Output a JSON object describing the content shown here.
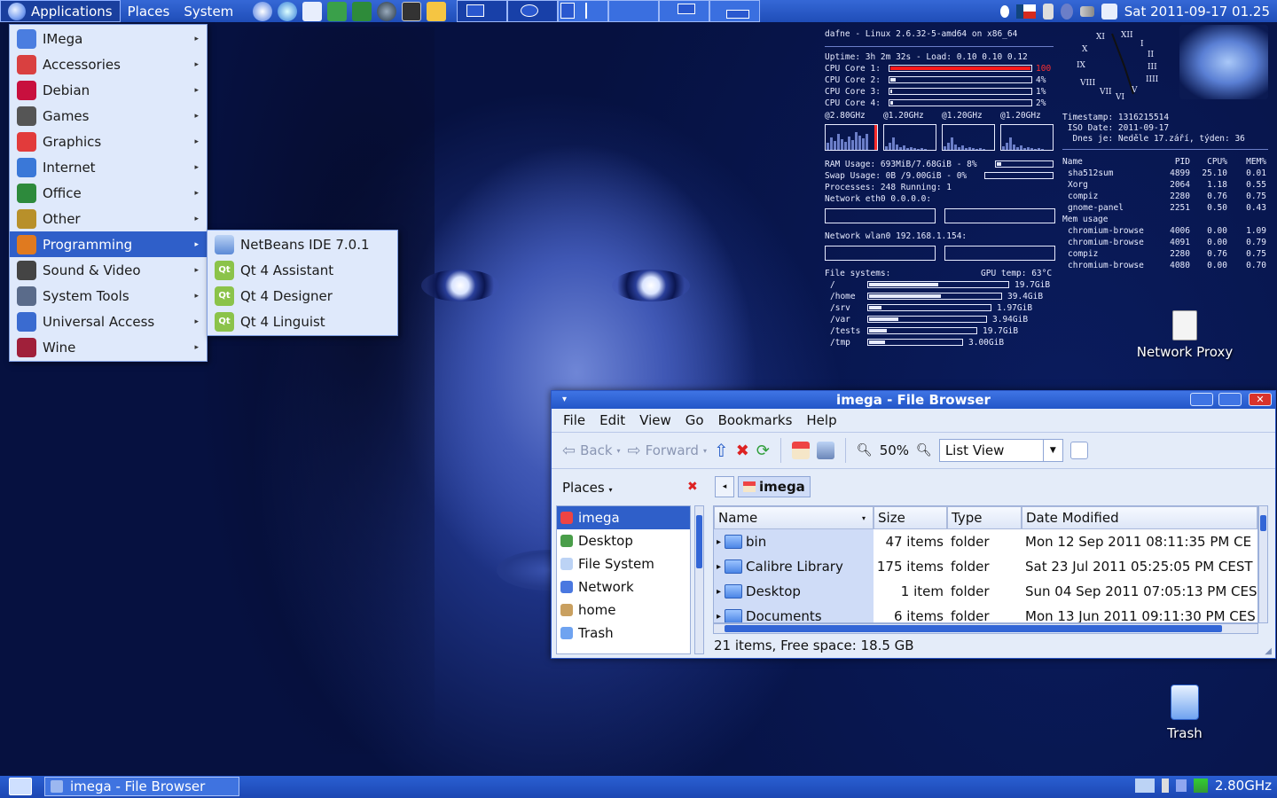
{
  "top_panel": {
    "menus": [
      "Applications",
      "Places",
      "System"
    ],
    "clock": "Sat 2011-09-17 01.25"
  },
  "app_menu": {
    "items": [
      {
        "label": "IMega",
        "icon": "imega-icon",
        "color": "#4a7de0"
      },
      {
        "label": "Accessories",
        "icon": "accessories-icon",
        "color": "#d94040"
      },
      {
        "label": "Debian",
        "icon": "debian-icon",
        "color": "#c8103e"
      },
      {
        "label": "Games",
        "icon": "games-icon",
        "color": "#555555"
      },
      {
        "label": "Graphics",
        "icon": "graphics-icon",
        "color": "#e23b3b"
      },
      {
        "label": "Internet",
        "icon": "internet-icon",
        "color": "#3a78d8"
      },
      {
        "label": "Office",
        "icon": "office-icon",
        "color": "#2d8a3c"
      },
      {
        "label": "Other",
        "icon": "other-icon",
        "color": "#b8902a"
      },
      {
        "label": "Programming",
        "icon": "programming-icon",
        "color": "#e07a1f"
      },
      {
        "label": "Sound & Video",
        "icon": "sound-video-icon",
        "color": "#444444"
      },
      {
        "label": "System Tools",
        "icon": "system-tools-icon",
        "color": "#5a6b8a"
      },
      {
        "label": "Universal Access",
        "icon": "universal-access-icon",
        "color": "#3a6bd0"
      },
      {
        "label": "Wine",
        "icon": "wine-icon",
        "color": "#a0203a"
      }
    ],
    "selected": "Programming"
  },
  "programming_submenu": {
    "items": [
      "NetBeans IDE 7.0.1",
      "Qt 4 Assistant",
      "Qt 4 Designer",
      "Qt 4 Linguist"
    ]
  },
  "conky": {
    "header": "dafne - Linux 2.6.32-5-amd64 on x86_64",
    "uptime": "Uptime: 3h 2m 32s - Load: 0.10 0.10 0.12",
    "cpus": [
      {
        "label": "CPU Core 1:",
        "value": "100",
        "fraction": 1.0
      },
      {
        "label": "CPU Core 2:",
        "value": "4%",
        "fraction": 0.04
      },
      {
        "label": "CPU Core 3:",
        "value": "1%",
        "fraction": 0.01
      },
      {
        "label": "CPU Core 4:",
        "value": "2%",
        "fraction": 0.02
      }
    ],
    "freqs": [
      "@2.80GHz",
      "@1.20GHz",
      "@1.20GHz",
      "@1.20GHz"
    ],
    "ram": "RAM Usage: 693MiB/7.68GiB - 8%",
    "ram_fraction": 0.08,
    "swap": "Swap Usage: 0B /9.00GiB - 0%",
    "swap_fraction": 0.0,
    "processes": "Processes: 248 Running: 1",
    "net_eth0": "Network eth0 0.0.0.0:",
    "net_wlan0": "Network wlan0 192.168.1.154:",
    "fs_title": "File systems:",
    "gpu_temp": "GPU temp: 63°C",
    "filesystems": [
      {
        "mount": "/",
        "size": "19.7GiB",
        "fraction": 0.5
      },
      {
        "mount": "/home",
        "size": "39.4GiB",
        "fraction": 0.55
      },
      {
        "mount": "/srv",
        "size": "1.97GiB",
        "fraction": 0.1
      },
      {
        "mount": "/var",
        "size": "3.94GiB",
        "fraction": 0.25
      },
      {
        "mount": "/tests",
        "size": "19.7GiB",
        "fraction": 0.17
      },
      {
        "mount": "/tmp",
        "size": "3.00GiB",
        "fraction": 0.17
      }
    ],
    "time_lines": [
      "Timestamp: 1316215514",
      " ISO Date: 2011-09-17",
      "  Dnes je: Neděle 17.září, týden: 36"
    ],
    "top_header": [
      "Name",
      "PID",
      "CPU%",
      "MEM%"
    ],
    "top_cpu": [
      [
        "sha512sum",
        "4899",
        "25.10",
        "0.01"
      ],
      [
        "Xorg",
        "2064",
        "1.18",
        "0.55"
      ],
      [
        "compiz",
        "2280",
        "0.76",
        "0.75"
      ],
      [
        "gnome-panel",
        "2251",
        "0.50",
        "0.43"
      ]
    ],
    "mem_label": "Mem usage",
    "top_mem": [
      [
        "chromium-browse",
        "4006",
        "0.00",
        "1.09"
      ],
      [
        "chromium-browse",
        "4091",
        "0.00",
        "0.79"
      ],
      [
        "compiz",
        "2280",
        "0.76",
        "0.75"
      ],
      [
        "chromium-browse",
        "4080",
        "0.00",
        "0.70"
      ]
    ]
  },
  "desktop_icons": {
    "network_proxy": "Network Proxy",
    "trash": "Trash"
  },
  "file_browser": {
    "title": "imega - File Browser",
    "menu": [
      "File",
      "Edit",
      "View",
      "Go",
      "Bookmarks",
      "Help"
    ],
    "toolbar": {
      "back": "Back",
      "forward": "Forward",
      "zoom": "50%",
      "view_mode": "List View"
    },
    "places_label": "Places",
    "places": [
      "imega",
      "Desktop",
      "File System",
      "Network",
      "home",
      "Trash"
    ],
    "path_current": "imega",
    "columns": [
      "Name",
      "Size",
      "Type",
      "Date Modified"
    ],
    "rows": [
      {
        "name": "bin",
        "size": "47 items",
        "type": "folder",
        "date": "Mon 12 Sep 2011 08:11:35 PM CE"
      },
      {
        "name": "Calibre Library",
        "size": "175 items",
        "type": "folder",
        "date": "Sat 23 Jul 2011 05:25:05 PM CEST"
      },
      {
        "name": "Desktop",
        "size": "1 item",
        "type": "folder",
        "date": "Sun 04 Sep 2011 07:05:13 PM CES"
      },
      {
        "name": "Documents",
        "size": "6 items",
        "type": "folder",
        "date": "Mon 13 Jun 2011 09:11:30 PM CES"
      }
    ],
    "status": "21 items, Free space: 18.5 GB"
  },
  "bottom_panel": {
    "task": "imega - File Browser",
    "cpu_freq": "2.80GHz"
  }
}
